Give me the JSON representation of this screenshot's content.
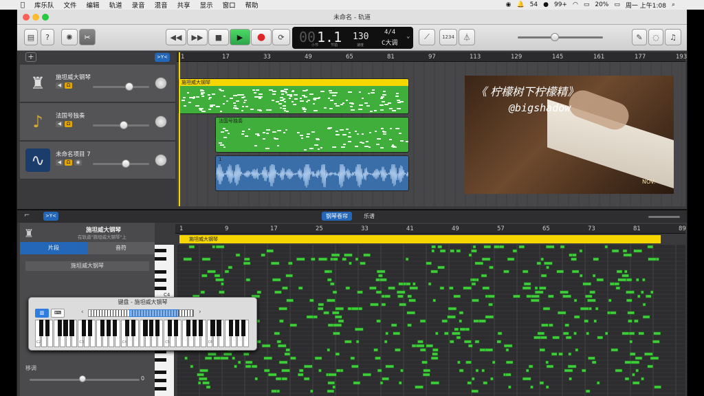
{
  "menubar": {
    "items": [
      "库乐队",
      "文件",
      "编辑",
      "轨道",
      "录音",
      "混音",
      "共享",
      "显示",
      "窗口",
      "帮助"
    ],
    "status": [
      "54",
      "99+",
      "20%",
      "周一 上午1:08"
    ]
  },
  "window": {
    "title": "未命名 - 轨道"
  },
  "lcd": {
    "position": "1.1",
    "pos_small_left": "小节",
    "pos_small_right": "节拍",
    "tempo": "130",
    "tempo_label": "速度",
    "signature": "4/4",
    "key": "C大调",
    "count": "1234"
  },
  "tracks": [
    {
      "name": "施坦威大钢琴",
      "icon": "grand-piano-icon",
      "vol": 0.65
    },
    {
      "name": "法国号独奏",
      "icon": "french-horn-icon",
      "vol": 0.55
    },
    {
      "name": "未命名项目 7",
      "icon": "waveform-icon",
      "vol": 0.58
    }
  ],
  "ruler_top": [
    "1",
    "17",
    "33",
    "49",
    "65",
    "81",
    "97",
    "113",
    "129",
    "145",
    "161",
    "177",
    "193"
  ],
  "regions": {
    "piano": "施坦威大钢琴",
    "horn": "法国号独奏",
    "audio": "1"
  },
  "overlay": {
    "title": "《 柠檬树下柠檬精》",
    "handle": "@bigshadow",
    "tag": "NOV."
  },
  "editor": {
    "tabs": [
      "钢琴卷帘",
      "乐谱"
    ],
    "track_title": "施坦威大钢琴",
    "track_sub": "在轨道\"施坦威大钢琴\"上",
    "inspector_tabs": [
      "片段",
      "音符"
    ],
    "region_name": "施坦威大钢琴",
    "transpose_label": "移调",
    "transpose_value": "0",
    "c4_label": "C4",
    "ruler": [
      "1",
      "9",
      "17",
      "25",
      "33",
      "41",
      "49",
      "57",
      "65",
      "73",
      "81",
      "89"
    ],
    "region_title": "施坦威大钢琴"
  },
  "keyboard": {
    "title": "键盘 - 施坦威大钢琴",
    "octaves": [
      "C2",
      "C3",
      "C4",
      "C5",
      "C6"
    ]
  }
}
